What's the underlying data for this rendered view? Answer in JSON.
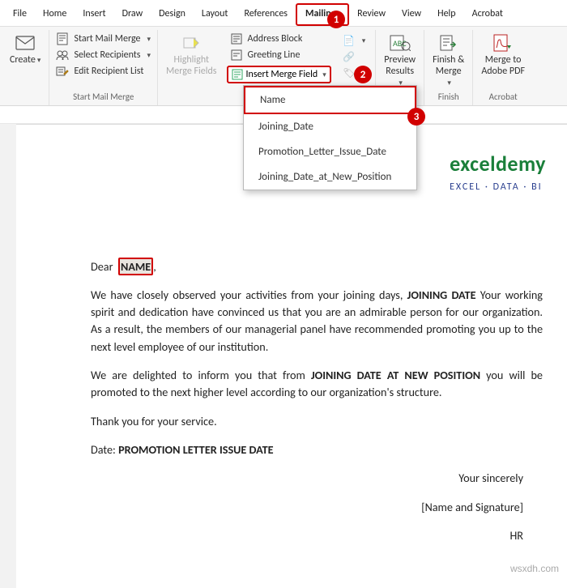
{
  "menu": {
    "items": [
      "File",
      "Home",
      "Insert",
      "Draw",
      "Design",
      "Layout",
      "References",
      "Mailings",
      "Review",
      "View",
      "Help",
      "Acrobat"
    ],
    "activeIndex": 7
  },
  "ribbon": {
    "create": {
      "label": "Create"
    },
    "startMailMerge": {
      "label": "Start Mail Merge"
    },
    "selectRecipients": {
      "label": "Select Recipients"
    },
    "editRecipientList": {
      "label": "Edit Recipient List"
    },
    "groupStartLabel": "Start Mail Merge",
    "highlightMergeFields": {
      "label": "Highlight\nMerge Fields"
    },
    "addressBlock": {
      "label": "Address Block"
    },
    "greetingLine": {
      "label": "Greeting Line"
    },
    "insertMergeField": {
      "label": "Insert Merge Field"
    },
    "previewResults": {
      "label": "Preview\nResults"
    },
    "finishMerge": {
      "label": "Finish &\nMerge"
    },
    "groupFinishLabel": "Finish",
    "mergeAdobe": {
      "label": "Merge to\nAdobe PDF"
    },
    "groupAcrobatLabel": "Acrobat"
  },
  "callouts": {
    "c1": "1",
    "c2": "2",
    "c3": "3"
  },
  "dropdown": {
    "items": [
      "Name",
      "Joining_Date",
      "Promotion_Letter_Issue_Date",
      "Joining_Date_at_New_Position"
    ],
    "selectedIndex": 0
  },
  "logo": {
    "title": "exceldemy",
    "subtitle": "EXCEL · DATA · BI"
  },
  "doc": {
    "dear": "Dear",
    "nameField": "NAME",
    "comma": ",",
    "p1a": "We have closely observed your activities from your joining days, ",
    "jd": "JOINING DATE",
    "p1b": " Your working spirit and dedication have convinced us that you are an admirable person for our organization. As a result, the members of our managerial panel have recommended promoting you up to the next level employee of our institution.",
    "p2a": "We are delighted to inform you that from ",
    "jdnp": "JOINING DATE AT NEW POSITION",
    "p2b": " you will be promoted to the next higher level according to our organization's structure.",
    "thank": "Thank you for your service.",
    "dateLabel": "Date: ",
    "plid": "PROMOTION LETTER ISSUE DATE",
    "sig1": "Your sincerely",
    "sig2": "[Name and Signature]",
    "sig3": "HR"
  },
  "watermark": "wsxdh.com"
}
